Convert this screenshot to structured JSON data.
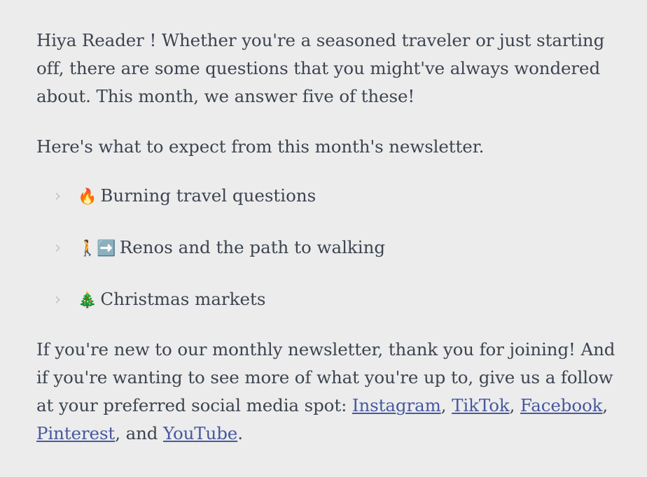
{
  "newsletter": {
    "intro_paragraph": "Hiya Reader ! Whether you're a seasoned traveler or just starting off, there are some questions that you might've always wondered about. This month, we answer five of these!",
    "expect_paragraph": "Here's what to expect from this month's newsletter.",
    "toc": {
      "marker": "›",
      "marker_color": "#b6b6b6",
      "items": [
        {
          "emoji": "🔥",
          "emoji_name": "fire-emoji",
          "label": "Burning travel questions"
        },
        {
          "emoji": "🚶➡️",
          "emoji_name": "walking-person-right-arrow-emoji",
          "label": "Renos and the path to walking"
        },
        {
          "emoji": "🎄",
          "emoji_name": "christmas-tree-emoji",
          "label": "Christmas markets"
        }
      ]
    },
    "closing": {
      "lead_text": "If you're new to our monthly newsletter, thank you for joining! And if you're wanting to see more of what you're up to, give us a follow at your preferred social media spot: ",
      "links": [
        {
          "label": "Instagram",
          "separator": ", "
        },
        {
          "label": "TikTok",
          "separator": ", "
        },
        {
          "label": "Facebook",
          "separator": ", "
        },
        {
          "label": "Pinterest",
          "separator": ", and "
        },
        {
          "label": "YouTube",
          "separator": "."
        }
      ]
    }
  },
  "theme": {
    "background": "#ececec",
    "text_color": "#3c4450",
    "link_color": "#46589e",
    "marker_color": "#b6b6b6"
  }
}
